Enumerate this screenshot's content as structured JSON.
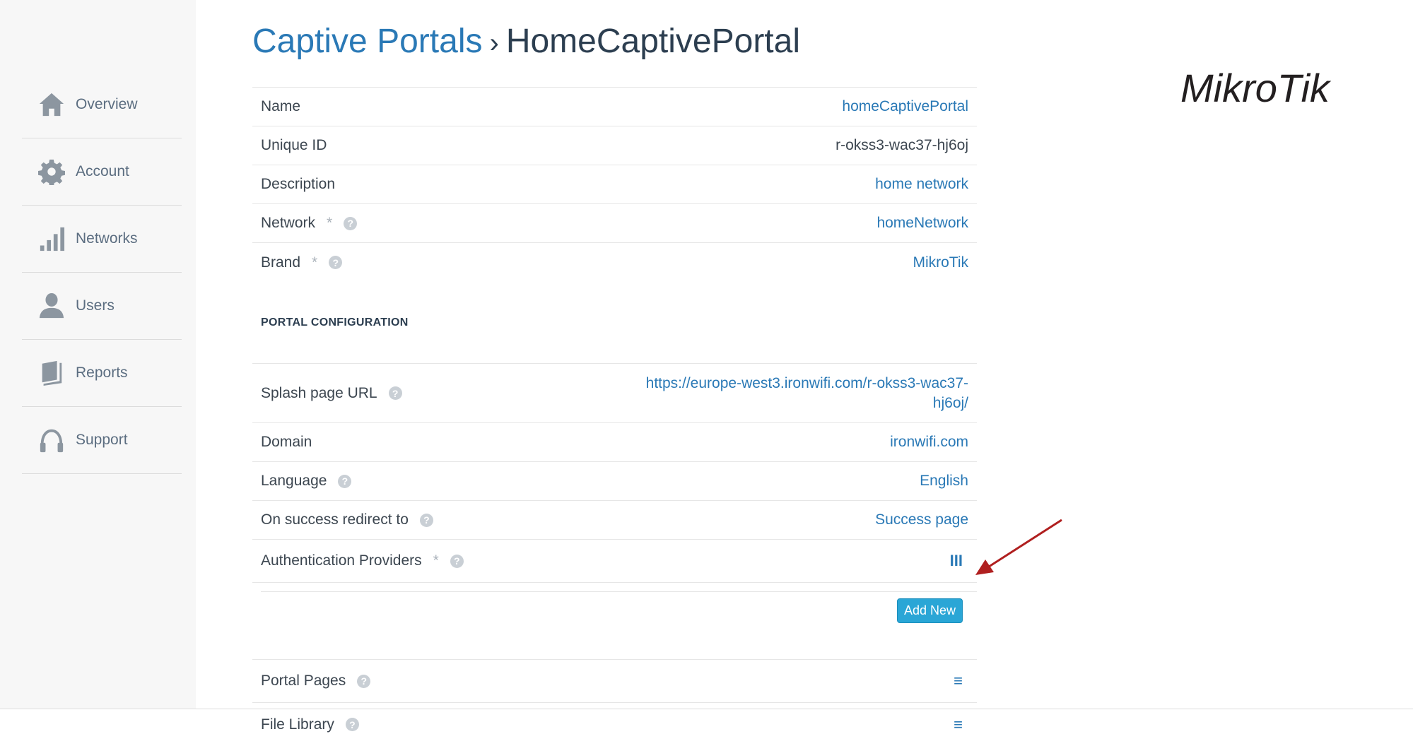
{
  "sidebar": {
    "items": [
      {
        "label": "Overview",
        "icon": "home-icon"
      },
      {
        "label": "Account",
        "icon": "gear-icon"
      },
      {
        "label": "Networks",
        "icon": "signal-bars-icon"
      },
      {
        "label": "Users",
        "icon": "user-icon"
      },
      {
        "label": "Reports",
        "icon": "book-icon"
      },
      {
        "label": "Support",
        "icon": "headphones-icon"
      }
    ]
  },
  "breadcrumb": {
    "parent": "Captive Portals",
    "separator": "›",
    "current": "HomeCaptivePortal"
  },
  "details": {
    "name": {
      "label": "Name",
      "value": "homeCaptivePortal"
    },
    "unique_id": {
      "label": "Unique ID",
      "value": "r-okss3-wac37-hj6oj"
    },
    "description": {
      "label": "Description",
      "value": "home network"
    },
    "network": {
      "label": "Network",
      "required": "*",
      "value": "homeNetwork"
    },
    "brand": {
      "label": "Brand",
      "required": "*",
      "value": "MikroTik"
    }
  },
  "portal_config": {
    "heading": "PORTAL CONFIGURATION",
    "splash_url": {
      "label": "Splash page URL",
      "value_line1": "https://europe-west3.ironwifi.com/r-okss3-wac37-",
      "value_line2": "hj6oj/"
    },
    "domain": {
      "label": "Domain",
      "value": "ironwifi.com"
    },
    "language": {
      "label": "Language",
      "value": "English"
    },
    "redirect": {
      "label": "On success redirect to",
      "value": "Success page"
    },
    "auth_providers": {
      "label": "Authentication Providers",
      "required": "*",
      "value": "III"
    },
    "add_new_label": "Add New",
    "portal_pages": {
      "label": "Portal Pages",
      "value": "≡"
    },
    "file_library": {
      "label": "File Library",
      "value": "≡"
    }
  },
  "help_glyph": "?",
  "logo": {
    "brand": "MikroTik",
    "color": "#231f20"
  },
  "colors": {
    "link": "#2a79b6",
    "button": "#2aa6d6",
    "arrow": "#b01f1f"
  }
}
